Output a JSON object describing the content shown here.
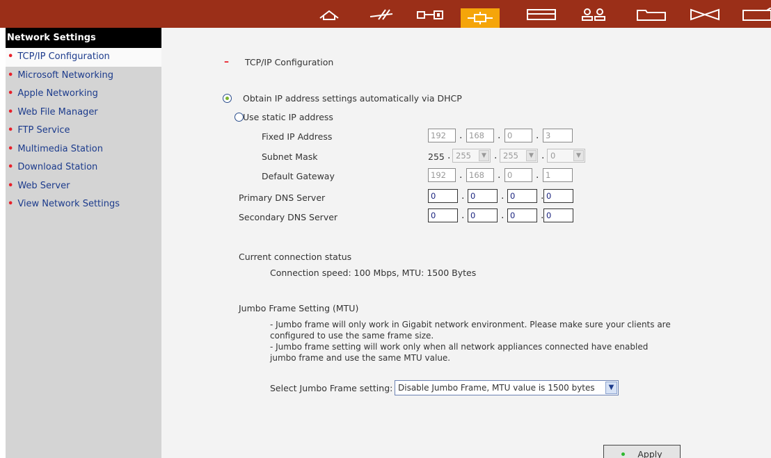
{
  "topnav": {
    "icons": [
      "home-icon",
      "system-icon",
      "disk-icon",
      "network-icon",
      "device-icon",
      "users-icon",
      "share-icon",
      "applications-icon",
      "more-icon"
    ],
    "active": "network-icon",
    "accent": "#f5a50a",
    "bar_color": "#9b2f18"
  },
  "sidebar": {
    "title": "Network Settings",
    "items": [
      {
        "label": "TCP/IP Configuration"
      },
      {
        "label": "Microsoft Networking"
      },
      {
        "label": "Apple Networking"
      },
      {
        "label": "Web File Manager"
      },
      {
        "label": "FTP Service"
      },
      {
        "label": "Multimedia Station"
      },
      {
        "label": "Download Station"
      },
      {
        "label": "Web Server"
      },
      {
        "label": "View Network Settings"
      }
    ]
  },
  "main": {
    "section_marker": "–",
    "section_title": "TCP/IP Configuration",
    "dhcp_label": "Obtain IP address settings automatically via DHCP",
    "static_label": "Use static IP address",
    "fixed_ip_label": "Fixed IP Address",
    "fixed_ip": [
      "192",
      "168",
      "0",
      "3"
    ],
    "subnet_label": "Subnet Mask",
    "subnet_first": "255",
    "subnet": [
      "255",
      "255",
      "0"
    ],
    "gateway_label": "Default Gateway",
    "gateway": [
      "192",
      "168",
      "0",
      "1"
    ],
    "primary_dns_label": "Primary DNS Server",
    "primary_dns": [
      "0",
      "0",
      "0",
      "0"
    ],
    "secondary_dns_label": "Secondary DNS Server",
    "secondary_dns": [
      "0",
      "0",
      "0",
      "0"
    ],
    "status_label": "Current connection status",
    "status_value": "Connection speed: 100 Mbps, MTU: 1500 Bytes",
    "jumbo_label": "Jumbo Frame Setting (MTU)",
    "jumbo_note_1a": "- Jumbo frame will only work in Gigabit network environment. Please make sure your clients are",
    "jumbo_note_1b": "configured to use the same frame size.",
    "jumbo_note_2a": "- Jumbo frame setting will work only when all network appliances connected have enabled",
    "jumbo_note_2b": "jumbo frame and use the same MTU value.",
    "jumbo_select_label": "Select Jumbo Frame setting:",
    "jumbo_select_value": "Disable Jumbo Frame, MTU value is 1500 bytes",
    "apply_label": "Apply"
  }
}
